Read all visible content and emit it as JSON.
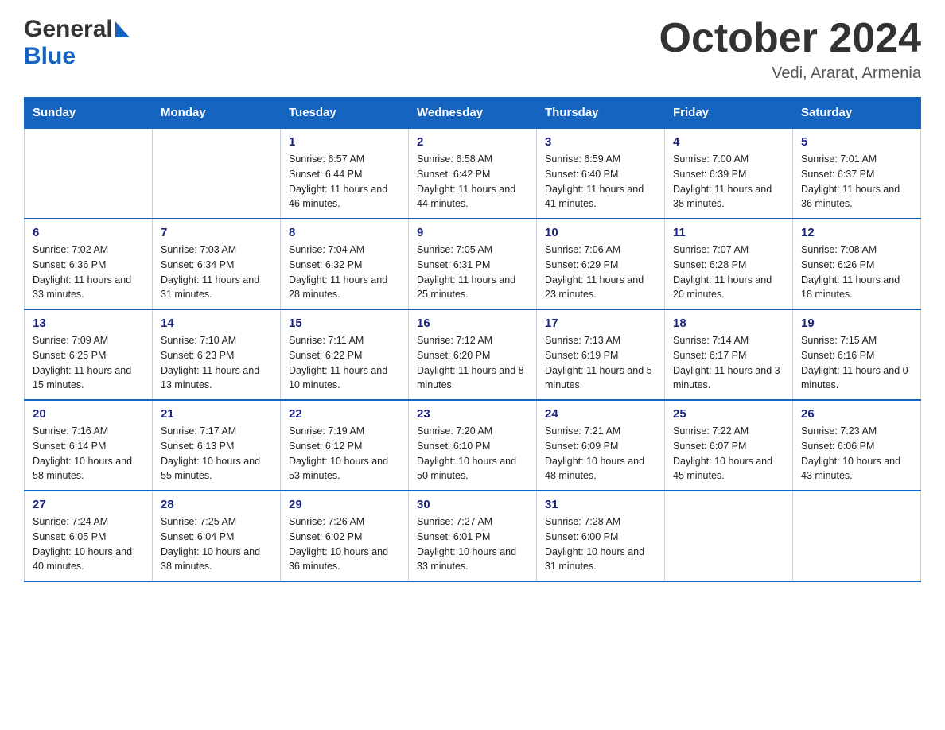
{
  "header": {
    "logo_general": "General",
    "logo_blue": "Blue",
    "month_title": "October 2024",
    "location": "Vedi, Ararat, Armenia"
  },
  "weekdays": [
    "Sunday",
    "Monday",
    "Tuesday",
    "Wednesday",
    "Thursday",
    "Friday",
    "Saturday"
  ],
  "weeks": [
    [
      {
        "day": "",
        "sunrise": "",
        "sunset": "",
        "daylight": ""
      },
      {
        "day": "",
        "sunrise": "",
        "sunset": "",
        "daylight": ""
      },
      {
        "day": "1",
        "sunrise": "Sunrise: 6:57 AM",
        "sunset": "Sunset: 6:44 PM",
        "daylight": "Daylight: 11 hours and 46 minutes."
      },
      {
        "day": "2",
        "sunrise": "Sunrise: 6:58 AM",
        "sunset": "Sunset: 6:42 PM",
        "daylight": "Daylight: 11 hours and 44 minutes."
      },
      {
        "day": "3",
        "sunrise": "Sunrise: 6:59 AM",
        "sunset": "Sunset: 6:40 PM",
        "daylight": "Daylight: 11 hours and 41 minutes."
      },
      {
        "day": "4",
        "sunrise": "Sunrise: 7:00 AM",
        "sunset": "Sunset: 6:39 PM",
        "daylight": "Daylight: 11 hours and 38 minutes."
      },
      {
        "day": "5",
        "sunrise": "Sunrise: 7:01 AM",
        "sunset": "Sunset: 6:37 PM",
        "daylight": "Daylight: 11 hours and 36 minutes."
      }
    ],
    [
      {
        "day": "6",
        "sunrise": "Sunrise: 7:02 AM",
        "sunset": "Sunset: 6:36 PM",
        "daylight": "Daylight: 11 hours and 33 minutes."
      },
      {
        "day": "7",
        "sunrise": "Sunrise: 7:03 AM",
        "sunset": "Sunset: 6:34 PM",
        "daylight": "Daylight: 11 hours and 31 minutes."
      },
      {
        "day": "8",
        "sunrise": "Sunrise: 7:04 AM",
        "sunset": "Sunset: 6:32 PM",
        "daylight": "Daylight: 11 hours and 28 minutes."
      },
      {
        "day": "9",
        "sunrise": "Sunrise: 7:05 AM",
        "sunset": "Sunset: 6:31 PM",
        "daylight": "Daylight: 11 hours and 25 minutes."
      },
      {
        "day": "10",
        "sunrise": "Sunrise: 7:06 AM",
        "sunset": "Sunset: 6:29 PM",
        "daylight": "Daylight: 11 hours and 23 minutes."
      },
      {
        "day": "11",
        "sunrise": "Sunrise: 7:07 AM",
        "sunset": "Sunset: 6:28 PM",
        "daylight": "Daylight: 11 hours and 20 minutes."
      },
      {
        "day": "12",
        "sunrise": "Sunrise: 7:08 AM",
        "sunset": "Sunset: 6:26 PM",
        "daylight": "Daylight: 11 hours and 18 minutes."
      }
    ],
    [
      {
        "day": "13",
        "sunrise": "Sunrise: 7:09 AM",
        "sunset": "Sunset: 6:25 PM",
        "daylight": "Daylight: 11 hours and 15 minutes."
      },
      {
        "day": "14",
        "sunrise": "Sunrise: 7:10 AM",
        "sunset": "Sunset: 6:23 PM",
        "daylight": "Daylight: 11 hours and 13 minutes."
      },
      {
        "day": "15",
        "sunrise": "Sunrise: 7:11 AM",
        "sunset": "Sunset: 6:22 PM",
        "daylight": "Daylight: 11 hours and 10 minutes."
      },
      {
        "day": "16",
        "sunrise": "Sunrise: 7:12 AM",
        "sunset": "Sunset: 6:20 PM",
        "daylight": "Daylight: 11 hours and 8 minutes."
      },
      {
        "day": "17",
        "sunrise": "Sunrise: 7:13 AM",
        "sunset": "Sunset: 6:19 PM",
        "daylight": "Daylight: 11 hours and 5 minutes."
      },
      {
        "day": "18",
        "sunrise": "Sunrise: 7:14 AM",
        "sunset": "Sunset: 6:17 PM",
        "daylight": "Daylight: 11 hours and 3 minutes."
      },
      {
        "day": "19",
        "sunrise": "Sunrise: 7:15 AM",
        "sunset": "Sunset: 6:16 PM",
        "daylight": "Daylight: 11 hours and 0 minutes."
      }
    ],
    [
      {
        "day": "20",
        "sunrise": "Sunrise: 7:16 AM",
        "sunset": "Sunset: 6:14 PM",
        "daylight": "Daylight: 10 hours and 58 minutes."
      },
      {
        "day": "21",
        "sunrise": "Sunrise: 7:17 AM",
        "sunset": "Sunset: 6:13 PM",
        "daylight": "Daylight: 10 hours and 55 minutes."
      },
      {
        "day": "22",
        "sunrise": "Sunrise: 7:19 AM",
        "sunset": "Sunset: 6:12 PM",
        "daylight": "Daylight: 10 hours and 53 minutes."
      },
      {
        "day": "23",
        "sunrise": "Sunrise: 7:20 AM",
        "sunset": "Sunset: 6:10 PM",
        "daylight": "Daylight: 10 hours and 50 minutes."
      },
      {
        "day": "24",
        "sunrise": "Sunrise: 7:21 AM",
        "sunset": "Sunset: 6:09 PM",
        "daylight": "Daylight: 10 hours and 48 minutes."
      },
      {
        "day": "25",
        "sunrise": "Sunrise: 7:22 AM",
        "sunset": "Sunset: 6:07 PM",
        "daylight": "Daylight: 10 hours and 45 minutes."
      },
      {
        "day": "26",
        "sunrise": "Sunrise: 7:23 AM",
        "sunset": "Sunset: 6:06 PM",
        "daylight": "Daylight: 10 hours and 43 minutes."
      }
    ],
    [
      {
        "day": "27",
        "sunrise": "Sunrise: 7:24 AM",
        "sunset": "Sunset: 6:05 PM",
        "daylight": "Daylight: 10 hours and 40 minutes."
      },
      {
        "day": "28",
        "sunrise": "Sunrise: 7:25 AM",
        "sunset": "Sunset: 6:04 PM",
        "daylight": "Daylight: 10 hours and 38 minutes."
      },
      {
        "day": "29",
        "sunrise": "Sunrise: 7:26 AM",
        "sunset": "Sunset: 6:02 PM",
        "daylight": "Daylight: 10 hours and 36 minutes."
      },
      {
        "day": "30",
        "sunrise": "Sunrise: 7:27 AM",
        "sunset": "Sunset: 6:01 PM",
        "daylight": "Daylight: 10 hours and 33 minutes."
      },
      {
        "day": "31",
        "sunrise": "Sunrise: 7:28 AM",
        "sunset": "Sunset: 6:00 PM",
        "daylight": "Daylight: 10 hours and 31 minutes."
      },
      {
        "day": "",
        "sunrise": "",
        "sunset": "",
        "daylight": ""
      },
      {
        "day": "",
        "sunrise": "",
        "sunset": "",
        "daylight": ""
      }
    ]
  ]
}
